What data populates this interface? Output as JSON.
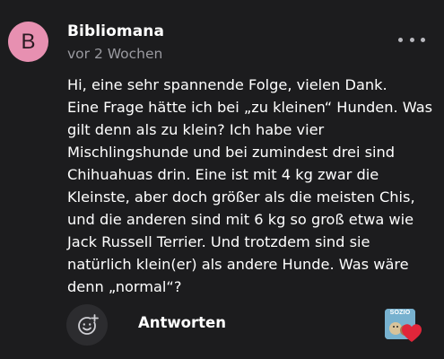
{
  "comment": {
    "avatar_letter": "B",
    "avatar_color": "#e790b1",
    "author": "Bibliomana",
    "timestamp": "vor 2 Wochen",
    "more_icon": "more-horizontal-icon",
    "lines": [
      "Hi, eine sehr spannende Folge, vielen Dank.",
      "Eine Frage hätte ich bei „zu kleinen“ Hunden. Was",
      "gilt denn als zu klein? Ich habe vier",
      "Mischlingshunde und bei zumindest drei sind",
      "Chihuahuas drin. Eine ist mit 4 kg zwar die",
      "Kleinste, aber doch größer als die meisten Chis,",
      "und die anderen sind mit 6 kg so groß etwa wie",
      "Jack Russell Terrier. Und trotzdem sind sie",
      "natürlich klein(er) als andere Hunde. Was wäre",
      "denn „normal“?"
    ]
  },
  "actions": {
    "emoji_icon": "add-reaction-icon",
    "reply_label": "Antworten"
  },
  "reaction": {
    "thumb_label": "SOZIO",
    "heart_icon": "heart-icon",
    "heart_color": "#e0263a"
  },
  "theme": {
    "background": "#1c1c1e",
    "muted_text": "#9a9aa0"
  }
}
